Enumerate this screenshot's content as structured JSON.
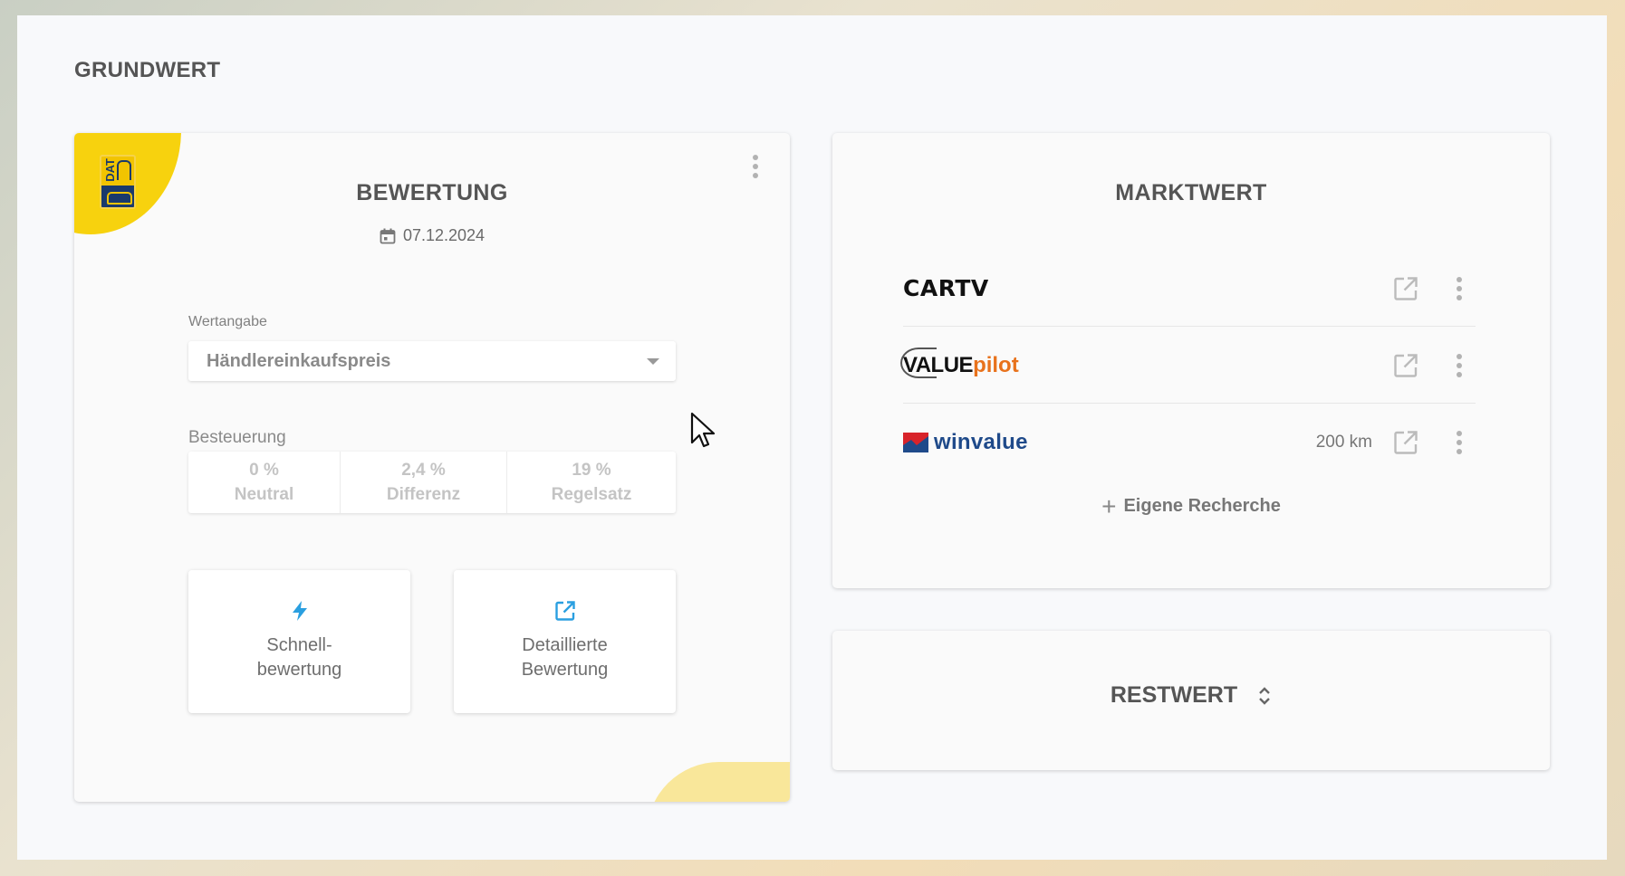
{
  "page": {
    "title": "GRUNDWERT"
  },
  "valuation": {
    "title": "BEWERTUNG",
    "date": "07.12.2024",
    "logo_text": "DAT",
    "value_type": {
      "label": "Wertangabe",
      "selected": "Händlereinkaufspreis"
    },
    "taxation": {
      "label": "Besteuerung",
      "options": [
        {
          "rate": "0 %",
          "name": "Neutral"
        },
        {
          "rate": "2,4 %",
          "name": "Differenz"
        },
        {
          "rate": "19 %",
          "name": "Regelsatz"
        }
      ]
    },
    "actions": {
      "quick": {
        "line1": "Schnell-",
        "line2": "bewertung"
      },
      "detailed": {
        "line1": "Detaillierte",
        "line2": "Bewertung"
      }
    }
  },
  "market": {
    "title": "MARKTWERT",
    "providers": [
      {
        "name": "CARTV",
        "extra": ""
      },
      {
        "name_value": "VALUE",
        "name_pilot": "pilot",
        "extra": ""
      },
      {
        "name": "winvalue",
        "extra": "200 km"
      }
    ],
    "add_label": "Eigene Recherche"
  },
  "residual": {
    "title": "RESTWERT"
  },
  "colors": {
    "accent_yellow": "#f7d20e",
    "icon_blue": "#2a9fe0",
    "valuepilot_orange": "#e8721c",
    "winvalue_blue": "#1f4a8a",
    "winvalue_red": "#d8232a"
  }
}
